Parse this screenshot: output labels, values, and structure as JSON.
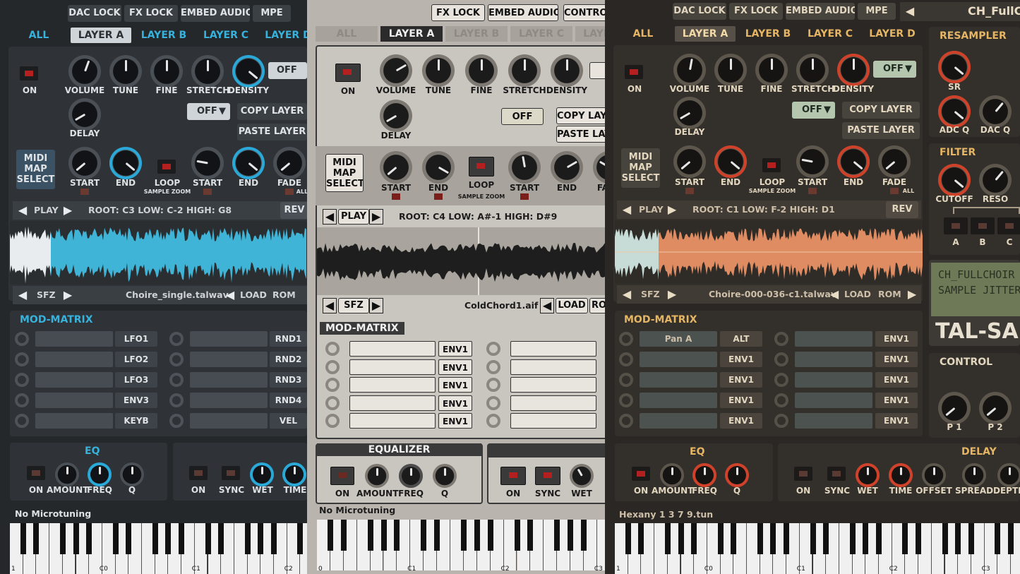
{
  "panel1": {
    "top_buttons": [
      "DAC LOCK",
      "FX LOCK",
      "EMBED AUDIO",
      "MPE"
    ],
    "tabs": [
      "ALL",
      "LAYER A",
      "LAYER B",
      "LAYER C",
      "LAYER D"
    ],
    "selected_tab": "LAYER A",
    "switch_on": "ON",
    "knobs_row1": [
      "VOLUME",
      "TUNE",
      "FINE",
      "STRETCH",
      "DENSITY"
    ],
    "off_dropdown_1": "OFF",
    "knob_delay": "DELAY",
    "off_dropdown_2": "OFF",
    "copy_layer": "COPY LAYER",
    "paste_layer": "PASTE LAYER",
    "midi_map_select": "MIDI MAP SELECT",
    "start": "START",
    "end": "END",
    "loop": "LOOP",
    "sample_zoom": "SAMPLE ZOOM",
    "start2": "START",
    "end2": "END",
    "fade": "FADE",
    "all_label": "ALL",
    "play": "PLAY",
    "root_info": "ROOT: C3  LOW: C-2  HIGH: G8",
    "rev": "REV",
    "sfz": "SFZ",
    "file_name": "Choire_single.talwav",
    "load": "LOAD",
    "rom": "ROM",
    "mod_matrix": "MOD-MATRIX",
    "mod_sources_left": [
      "LFO1",
      "LFO2",
      "LFO3",
      "ENV3",
      "KEYB"
    ],
    "mod_sources_right": [
      "RND1",
      "RND2",
      "RND3",
      "RND4",
      "VEL"
    ],
    "eq": "EQ",
    "eq_labels": [
      "ON",
      "AMOUNT",
      "FREQ",
      "Q"
    ],
    "fx_labels": [
      "ON",
      "SYNC",
      "WET",
      "TIME"
    ],
    "tuning": "No Microtuning",
    "octaves": [
      "1",
      "C0",
      "C1",
      "C2"
    ]
  },
  "panel2": {
    "top_buttons": [
      "FX LOCK",
      "EMBED AUDIO",
      "CONTROL"
    ],
    "tabs": [
      "ALL",
      "LAYER A",
      "LAYER B",
      "LAYER C",
      "LAYER D"
    ],
    "selected_tab": "LAYER A",
    "switch_on": "ON",
    "knobs_row1": [
      "VOLUME",
      "TUNE",
      "FINE",
      "STRETCH",
      "DENSITY"
    ],
    "knob_delay": "DELAY",
    "off_button": "OFF",
    "copy_layer": "COPY LAYER",
    "paste_layer": "PASTE LAYER",
    "midi_map_select": "MIDI MAP SELECT",
    "start": "START",
    "end": "END",
    "loop": "LOOP",
    "sample_zoom": "SAMPLE ZOOM",
    "start2": "START",
    "end2": "END",
    "fade": "FADE",
    "play": "PLAY",
    "root_info": "ROOT: C4  LOW: A#-1  HIGH: D#9",
    "sfz": "SFZ",
    "file_name": "ColdChord1.aif",
    "load": "LOAD",
    "rom": "ROM",
    "mod_matrix": "MOD-MATRIX",
    "mod_sources": [
      "ENV1",
      "ENV1",
      "ENV1",
      "ENV1",
      "ENV1"
    ],
    "equalizer": "EQUALIZER",
    "eq_labels": [
      "ON",
      "AMOUNT",
      "FREQ",
      "Q"
    ],
    "fx_labels": [
      "ON",
      "SYNC",
      "WET"
    ],
    "tuning": "No Microtuning",
    "octaves": [
      "0",
      "C1",
      "C2",
      "C3"
    ]
  },
  "panel3": {
    "top_buttons": [
      "DAC LOCK",
      "FX LOCK",
      "EMBED AUDIO",
      "MPE"
    ],
    "preset_name": "CH_FullChoir",
    "tabs": [
      "ALL",
      "LAYER A",
      "LAYER B",
      "LAYER C",
      "LAYER D"
    ],
    "selected_tab": "LAYER A",
    "switch_on": "ON",
    "knobs_row1": [
      "VOLUME",
      "TUNE",
      "FINE",
      "STRETCH",
      "DENSITY"
    ],
    "off_dropdown_1": "OFF",
    "knob_delay": "DELAY",
    "off_dropdown_2": "OFF",
    "copy_layer": "COPY LAYER",
    "paste_layer": "PASTE LAYER",
    "midi_map_select": "MIDI MAP SELECT",
    "start": "START",
    "end": "END",
    "loop": "LOOP",
    "sample_zoom": "SAMPLE ZOOM",
    "start2": "START",
    "end2": "END",
    "fade": "FADE",
    "all_label": "ALL",
    "play": "PLAY",
    "root_info": "ROOT: C1  LOW: F-2  HIGH: D1",
    "rev": "REV",
    "sfz": "SFZ",
    "file_name": "Choire-000-036-c1.talwav",
    "load": "LOAD",
    "rom": "ROM",
    "mod_matrix": "MOD-MATRIX",
    "mod_first_target": "Pan A",
    "mod_sources_left": [
      "ALT",
      "ENV1",
      "ENV1",
      "ENV1",
      "ENV1"
    ],
    "mod_sources_right": [
      "ENV1",
      "ENV1",
      "ENV1",
      "ENV1",
      "ENV1"
    ],
    "eq": "EQ",
    "eq_labels": [
      "ON",
      "AMOUNT",
      "FREQ",
      "Q"
    ],
    "delay": "DELAY",
    "delay_labels": [
      "ON",
      "SYNC",
      "WET",
      "TIME",
      "OFFSET",
      "SPREAD",
      "DEPTH"
    ],
    "tuning": "Hexany 1 3 7 9.tun",
    "octaves": [
      "1",
      "C0",
      "C1",
      "C2",
      "C3"
    ],
    "resampler": "RESAMPLER",
    "sr": "SR",
    "adc_q": "ADC Q",
    "dac_q": "DAC Q",
    "filter": "FILTER",
    "cutoff": "CUTOFF",
    "reso": "RESO",
    "abc": [
      "A",
      "B",
      "C"
    ],
    "lcd_line1": "CH_FULLCHOIR",
    "lcd_line2": "SAMPLE JITTER",
    "brand": "TAL-SAMPLER",
    "control": "CONTROL",
    "p1": "P 1",
    "p2": "P 2"
  },
  "colors": {
    "accent_blue": "#36b2dd",
    "accent_orange": "#e5b563",
    "wave_blue": "#3fb4d6",
    "wave_orange": "#e08c62",
    "led_red": "#b41f1f"
  }
}
